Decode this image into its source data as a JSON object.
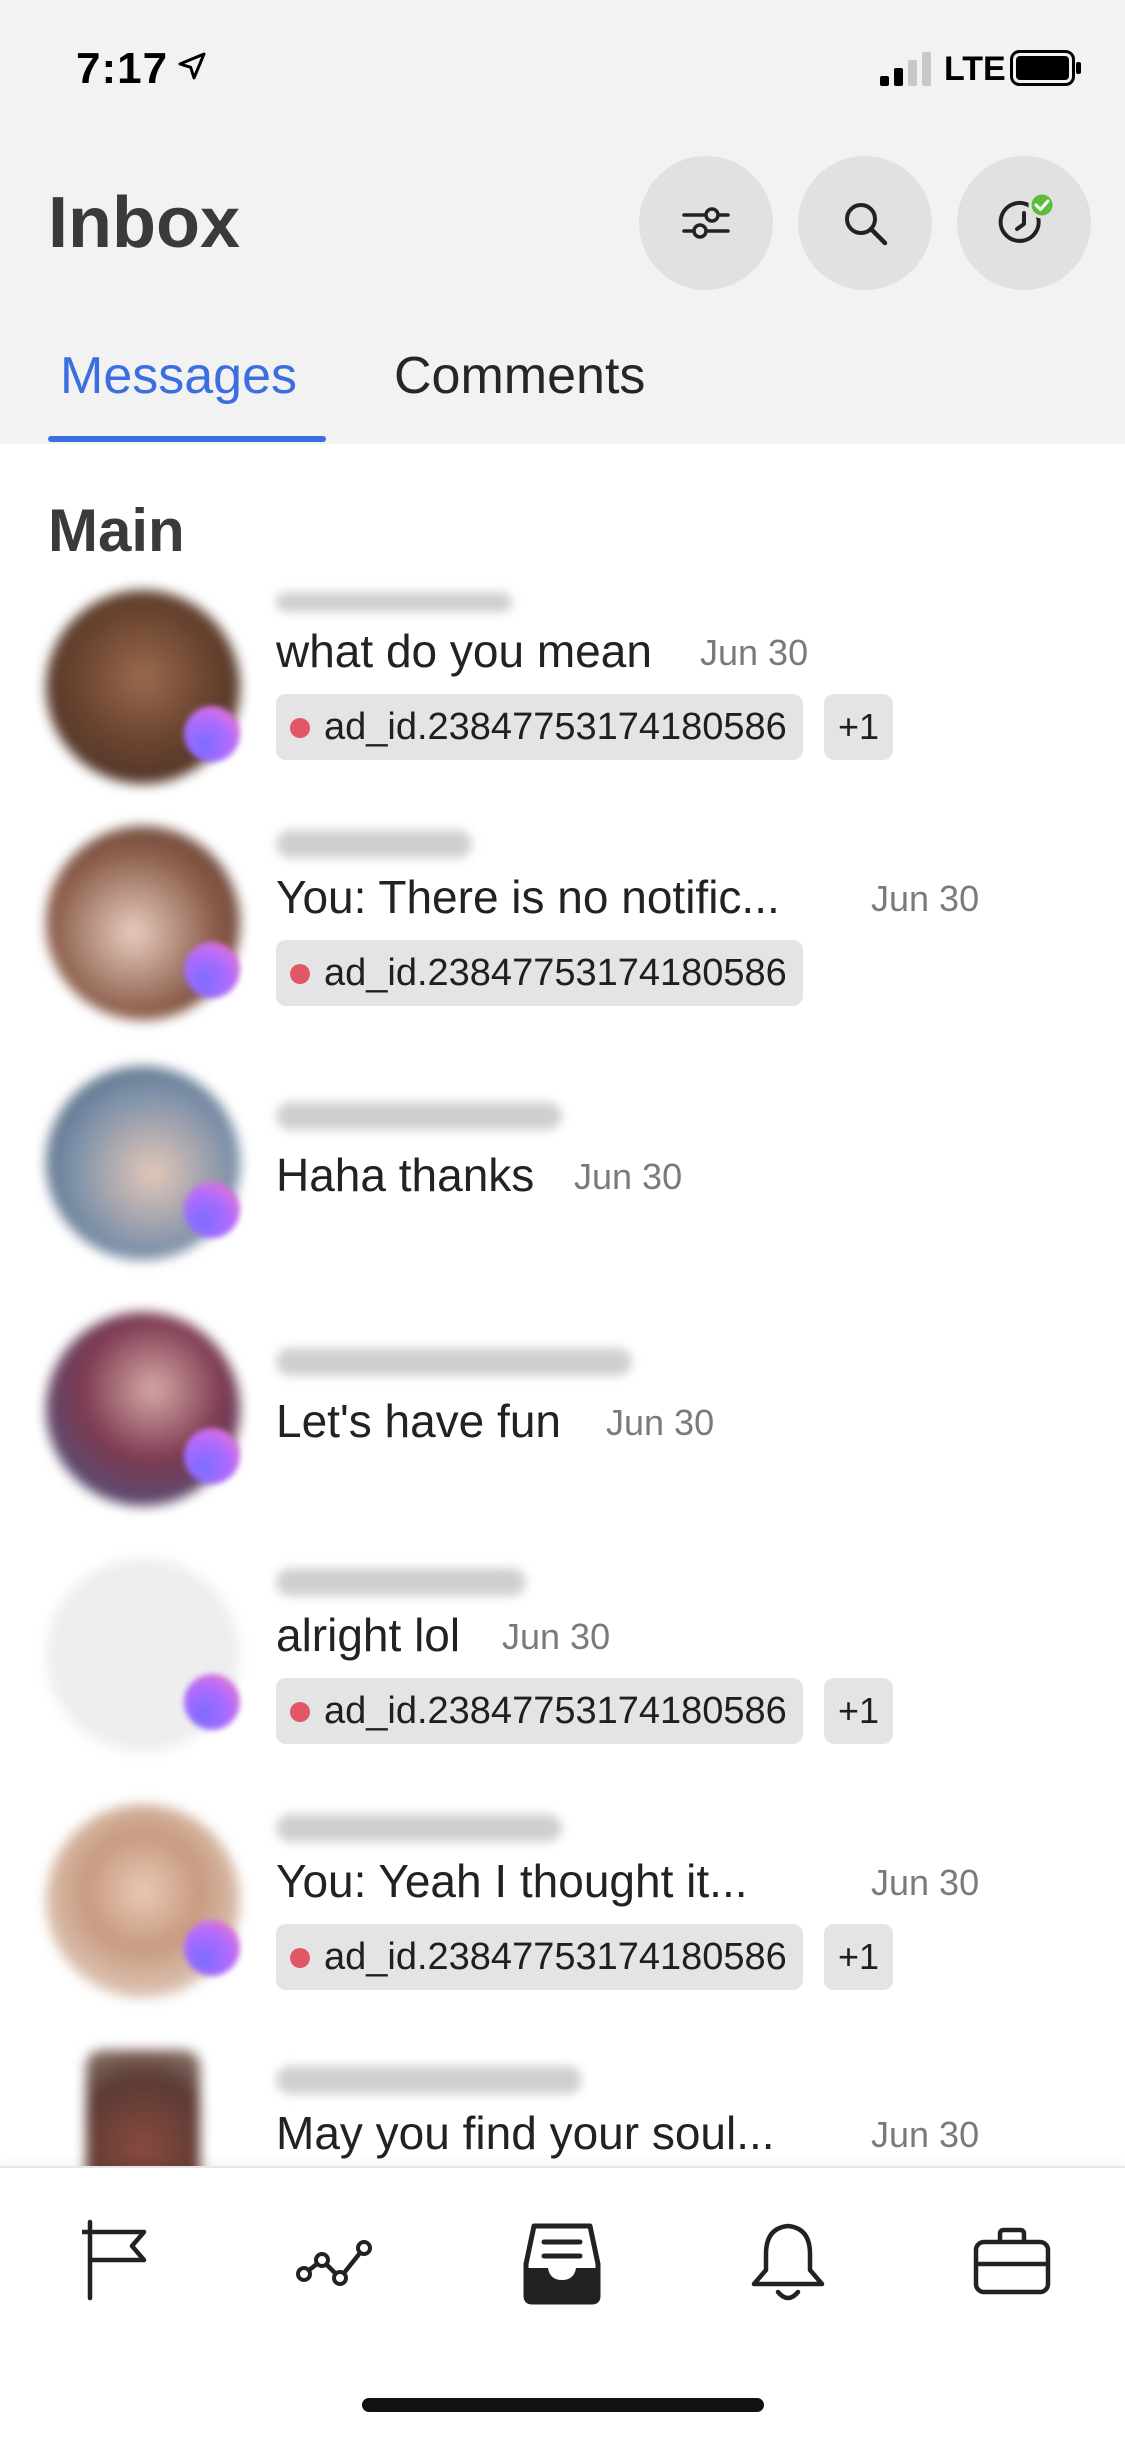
{
  "status_bar": {
    "time": "7:17",
    "network": "LTE"
  },
  "header": {
    "title": "Inbox"
  },
  "tabs": [
    {
      "label": "Messages"
    },
    {
      "label": "Comments"
    }
  ],
  "section": {
    "title": "Main"
  },
  "colors": {
    "accent": "#3b6fe0",
    "tag_dot": "#e15766",
    "online": "#5bbd3f"
  },
  "conversations": [
    {
      "message": "what do you mean",
      "date": "Jun 30",
      "tag": "ad_id.23847753174180586",
      "extra": "+1"
    },
    {
      "message": "You: There is no notific...",
      "date": "Jun 30",
      "tag": "ad_id.23847753174180586"
    },
    {
      "message": "Haha thanks",
      "date": "Jun 30"
    },
    {
      "message": "Let's have fun",
      "date": "Jun 30"
    },
    {
      "message": "alright lol",
      "date": "Jun 30",
      "tag": "ad_id.23847753174180586",
      "extra": "+1"
    },
    {
      "message": "You: Yeah I thought it...",
      "date": "Jun 30",
      "tag": "ad_id.23847753174180586",
      "extra": "+1"
    },
    {
      "message": "May you find your soul...",
      "date": "Jun 30"
    }
  ],
  "bottom_nav": [
    {
      "icon": "flag-icon"
    },
    {
      "icon": "insights-icon"
    },
    {
      "icon": "inbox-icon"
    },
    {
      "icon": "bell-icon"
    },
    {
      "icon": "briefcase-icon"
    }
  ]
}
